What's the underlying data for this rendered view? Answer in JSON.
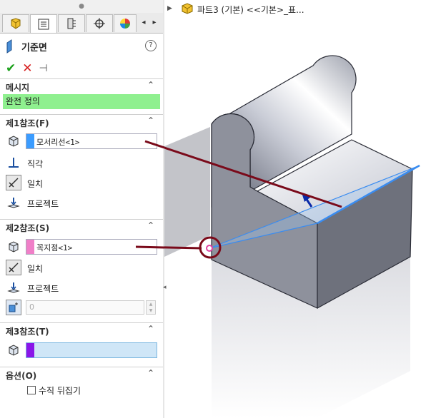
{
  "tabs": [
    {
      "name": "feature-manager-icon",
      "active": false
    },
    {
      "name": "property-manager-icon",
      "active": true
    },
    {
      "name": "configuration-manager-icon",
      "active": false
    },
    {
      "name": "dimxpert-icon",
      "active": false
    },
    {
      "name": "display-manager-icon",
      "active": false
    }
  ],
  "title": "기준면",
  "help": "?",
  "actions": {
    "ok": "✔",
    "cancel": "✕",
    "pin": "⊣"
  },
  "message_section": {
    "label": "메시지",
    "text": "완전 정의"
  },
  "ref1": {
    "label": "제1참조(F)",
    "selection": "모서리선<1>",
    "color": "#3b9cff",
    "options": [
      "직각",
      "일치",
      "프로젝트"
    ]
  },
  "ref2": {
    "label": "제2참조(S)",
    "selection": "꼭지점<1>",
    "color": "#f07fc8",
    "options": [
      "일치",
      "프로젝트"
    ],
    "offset_value": "0"
  },
  "ref3": {
    "label": "제3참조(T)",
    "color": "#8a16e8"
  },
  "options_section": {
    "label": "옵션(O)",
    "flip_normal": "수직 뒤집기"
  },
  "tree": {
    "item": "파트3 (기본) <<기본>_표..."
  },
  "colors": {
    "message_bg": "#8ff08f",
    "accent_red": "#7a0a1a",
    "preview_blue": "#3a8cf0"
  }
}
